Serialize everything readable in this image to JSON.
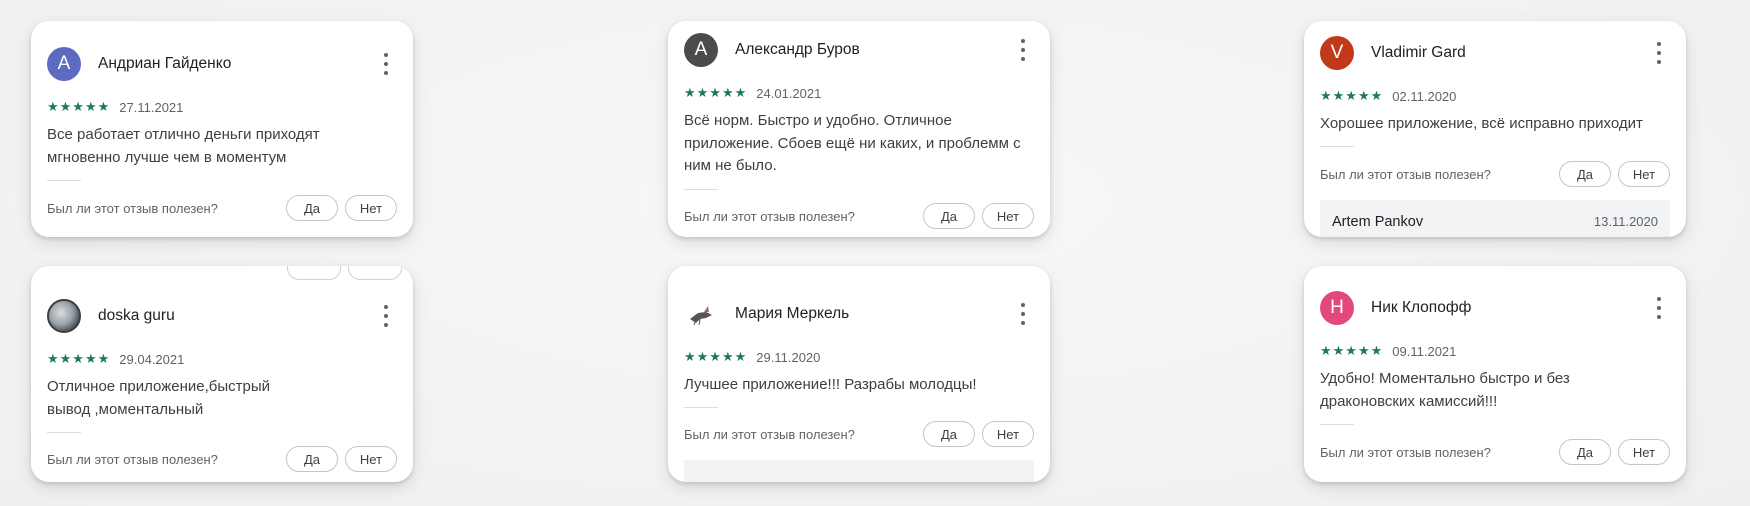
{
  "colors": {
    "star": "#1e7a52",
    "avatar_a1": "#5c6bc0",
    "avatar_a2": "#4b4b4b",
    "avatar_v": "#c0391b",
    "avatar_h": "#e2497a"
  },
  "helpful_question": "Был ли этот отзыв полезен?",
  "yes_label": "Да",
  "no_label": "Нет",
  "stars": "★★★★★",
  "reviews": [
    {
      "avatar_letter": "А",
      "name": "Андриан Гайденко",
      "date": "27.11.2021",
      "text": "Все работает отлично деньги приходят мгновенно лучше чем в моментум"
    },
    {
      "avatar_letter": "А",
      "name": "Александр Буров",
      "date": "24.01.2021",
      "text": "Всё норм. Быстро и удобно. Отличное приложение. Сбоев ещё ни каких, и проблемм с ним не было."
    },
    {
      "avatar_letter": "V",
      "name": "Vladimir Gard",
      "date": "02.11.2020",
      "text": "Хорошее приложение, всё исправно приходит",
      "reply": {
        "author": "Artem Pankov",
        "date": "13.11.2020"
      }
    },
    {
      "avatar_letter": "",
      "name": "doska guru",
      "date": "29.04.2021",
      "text": "Отличное приложение,быстрый вывод ,моментальный"
    },
    {
      "avatar_letter": "",
      "name": "Мария Меркель",
      "date": "29.11.2020",
      "text": "Лучшее приложение!!! Разрабы молодцы!"
    },
    {
      "avatar_letter": "Н",
      "name": "Ник Клопофф",
      "date": "09.11.2021",
      "text": "Удобно! Моментально быстро и без драконовских камиссий!!!"
    }
  ]
}
